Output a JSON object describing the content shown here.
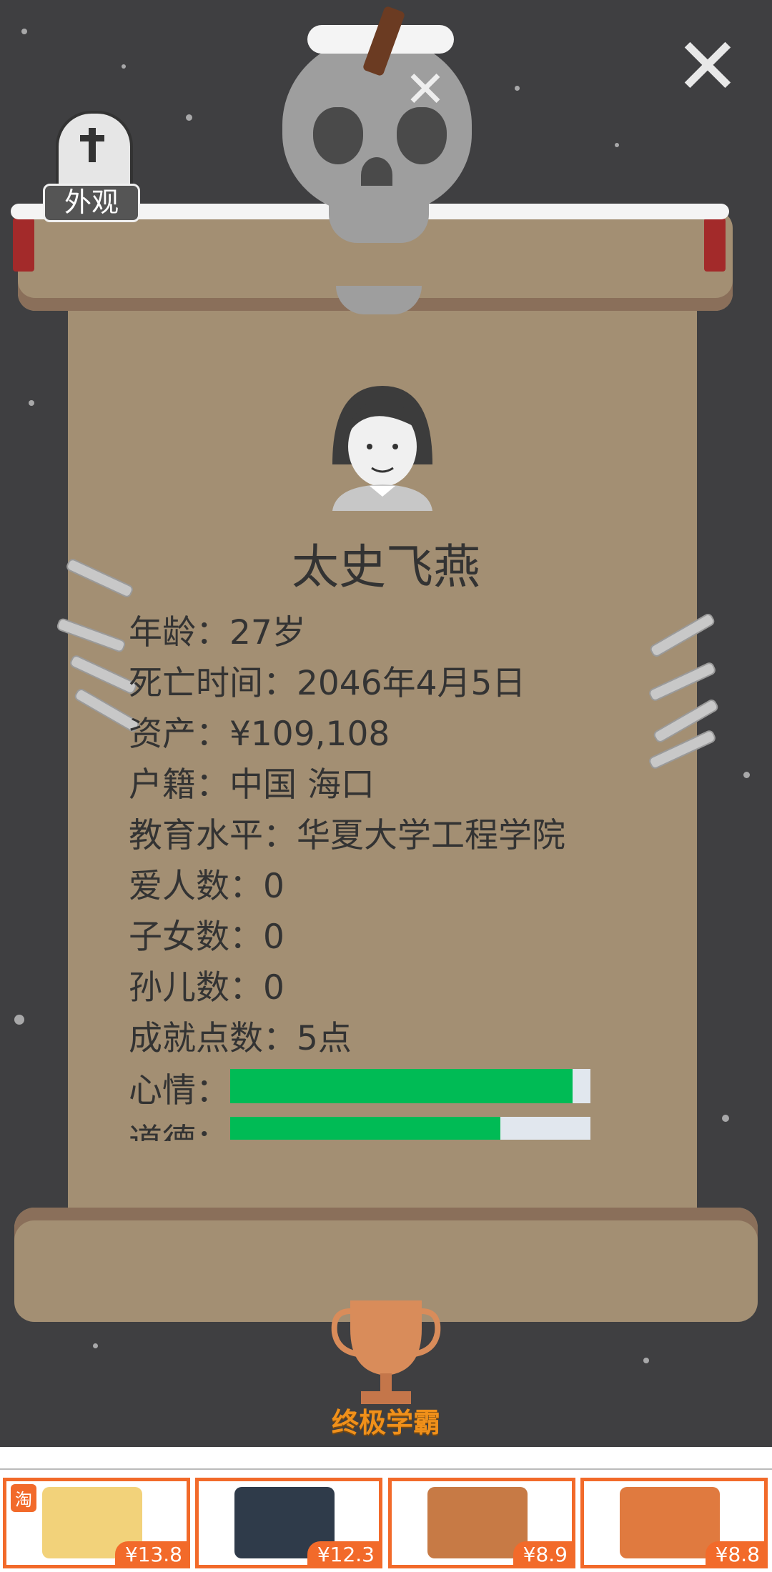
{
  "buttons": {
    "appearance": "外观"
  },
  "profile": {
    "name": "太史飞燕",
    "age": "年龄：27岁",
    "death_time": "死亡时间：2046年4月5日",
    "assets": "资产：¥109,108",
    "hometown": "户籍：中国 海口",
    "education": "教育水平：华夏大学工程学院",
    "lovers": "爱人数：0",
    "children": "子女数：0",
    "grandchildren": "孙儿数：0",
    "achievements": "成就点数：5点",
    "mood_label": "心情：",
    "mood_value": 0.95,
    "morality_label": "道德：",
    "morality_value": 0.75
  },
  "trophy": {
    "title": "终极学霸"
  },
  "ads": {
    "badge": "淘",
    "items": [
      {
        "price": "¥13.8"
      },
      {
        "price": "¥12.3"
      },
      {
        "price": "¥8.9"
      },
      {
        "price": "¥8.8"
      }
    ]
  }
}
